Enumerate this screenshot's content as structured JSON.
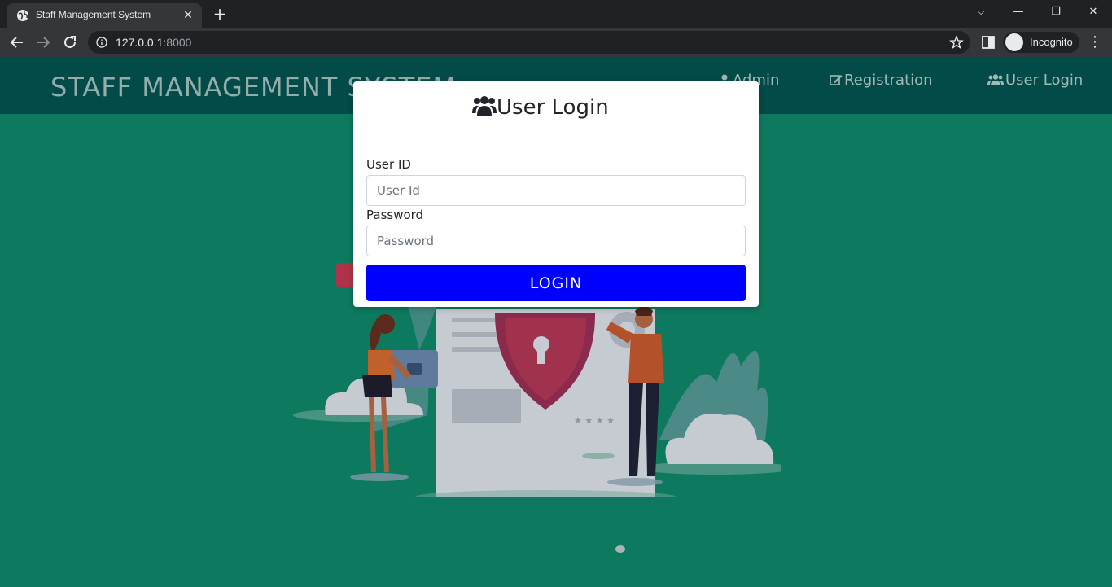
{
  "browser": {
    "tab_title": "Staff Management System",
    "url_host": "127.0.0.1",
    "url_port": ":8000",
    "incognito_label": "Incognito"
  },
  "site": {
    "brand": "STAFF MANAGEMENT SYSTEM",
    "nav": [
      {
        "label": "Admin",
        "icon": "user-icon"
      },
      {
        "label": "Registration",
        "icon": "edit-icon"
      },
      {
        "label": "User Login",
        "icon": "users-icon"
      }
    ]
  },
  "modal": {
    "title": "User Login",
    "user_id_label": "User ID",
    "user_id_placeholder": "User Id",
    "password_label": "Password",
    "password_placeholder": "Password",
    "login_button": "LOGIN"
  },
  "colors": {
    "page_bg": "#0d7a5f",
    "navbar_bg": "#034b48",
    "button_bg": "#0000ff"
  }
}
